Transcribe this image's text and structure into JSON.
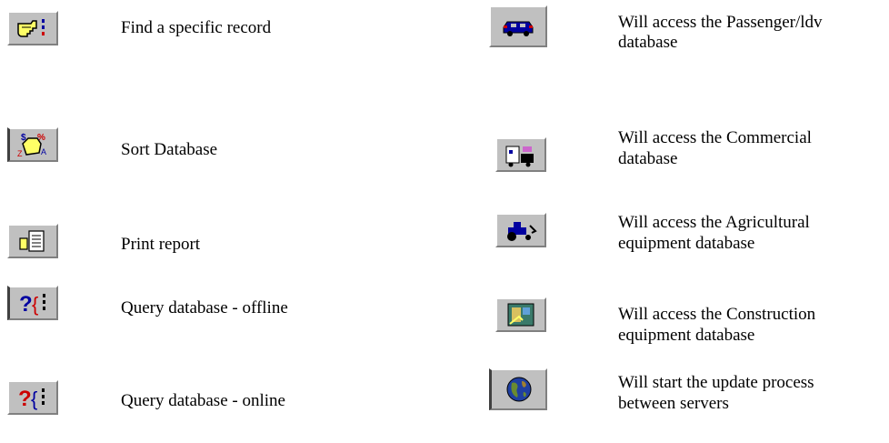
{
  "legend": {
    "left": [
      {
        "icon": "pointing-hand-icon",
        "label": "Find a specific record"
      },
      {
        "icon": "sort-hand-icon",
        "label": "Sort Database"
      },
      {
        "icon": "print-report-icon",
        "label": "Print report"
      },
      {
        "icon": "query-offline-icon",
        "label": "Query database - offline"
      },
      {
        "icon": "query-online-icon",
        "label": "Query database - online"
      }
    ],
    "right": [
      {
        "icon": "car-icon",
        "label_line1": " Will access the Passenger/ldv",
        "label_line2": "database"
      },
      {
        "icon": "truck-icon",
        "label_line1": "Will access the Commercial",
        "label_line2": "database"
      },
      {
        "icon": "tractor-icon",
        "label_line1": "Will access the Agricultural",
        "label_line2": "equipment database"
      },
      {
        "icon": "construction-icon",
        "label_line1": "Will access the Construction",
        "label_line2": "equipment database"
      },
      {
        "icon": "globe-icon",
        "label_line1": "Will start the update process",
        "label_line2": "between servers"
      }
    ]
  },
  "colors": {
    "button_face": "#c0c0c0",
    "accent_blue": "#0000a0",
    "accent_red": "#cc0000",
    "hand_yellow": "#ffff66"
  }
}
